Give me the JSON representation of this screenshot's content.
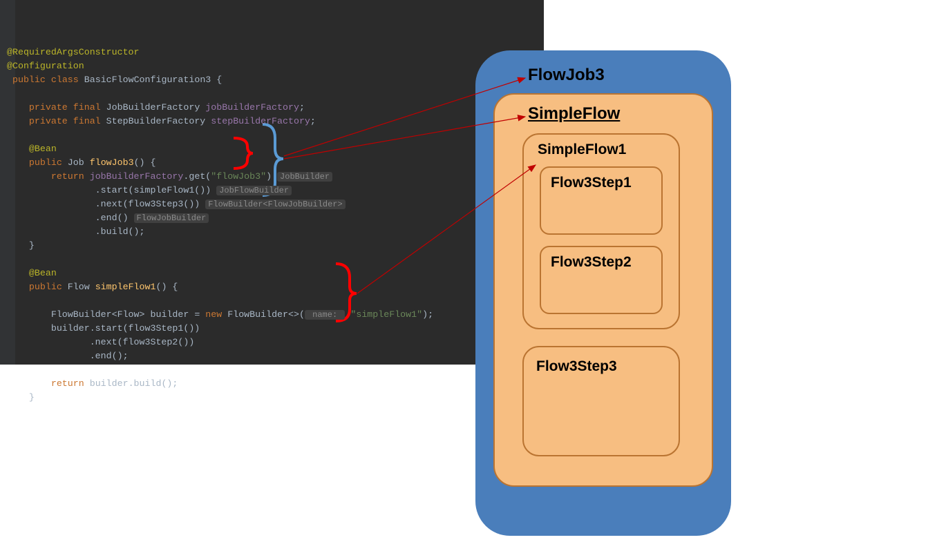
{
  "code": {
    "annot1": "@RequiredArgsConstructor",
    "annot2": "@Configuration",
    "decl_public": "public",
    "decl_class": "class",
    "decl_classname": "BasicFlowConfiguration3",
    "decl_brace": " {",
    "field_private": "private",
    "field_final": "final",
    "field1_type": "JobBuilderFactory",
    "field1_name": "jobBuilderFactory",
    "field2_type": "StepBuilderFactory",
    "field2_name": "stepBuilderFactory",
    "bean": "@Bean",
    "m1_public": "public",
    "m1_type": "Job",
    "m1_name": "flowJob3",
    "m1_sig": "() {",
    "m1_return": "return",
    "m1_field": "jobBuilderFactory",
    "m1_get": ".get(",
    "m1_getarg": "\"flowJob3\"",
    "m1_getclose": ")",
    "hint_jobbuilder": "JobBuilder",
    "m1_start": ".start(simpleFlow1())",
    "hint_jobflowbuilder": "JobFlowBuilder",
    "m1_next": ".next(flow3Step3())",
    "hint_flowbuilder": "FlowBuilder<FlowJobBuilder>",
    "m1_end": ".end()",
    "hint_flowjobbuilder": "FlowJobBuilder",
    "m1_build": ".build();",
    "m1_close": "}",
    "m2_public": "public",
    "m2_type": "Flow",
    "m2_name": "simpleFlow1",
    "m2_sig": "() {",
    "m2_declT": "FlowBuilder<Flow>",
    "m2_declV": "builder",
    "m2_eq": " = ",
    "m2_new": "new",
    "m2_newT": " FlowBuilder<>(",
    "m2_paramhint": " name: ",
    "m2_arg": "\"simpleFlow1\"",
    "m2_argclose": ");",
    "m2_start": "builder.start(flow3Step1())",
    "m2_next": ".next(flow3Step2())",
    "m2_end": ".end();",
    "m2_return": "return",
    "m2_retexpr": " builder.build();",
    "m2_close": "}"
  },
  "diagram": {
    "flowjob3": "FlowJob3",
    "simpleflow": "SimpleFlow",
    "simpleflow1": "SimpleFlow1",
    "step1": "Flow3Step1",
    "step2": "Flow3Step2",
    "step3": "Flow3Step3"
  }
}
